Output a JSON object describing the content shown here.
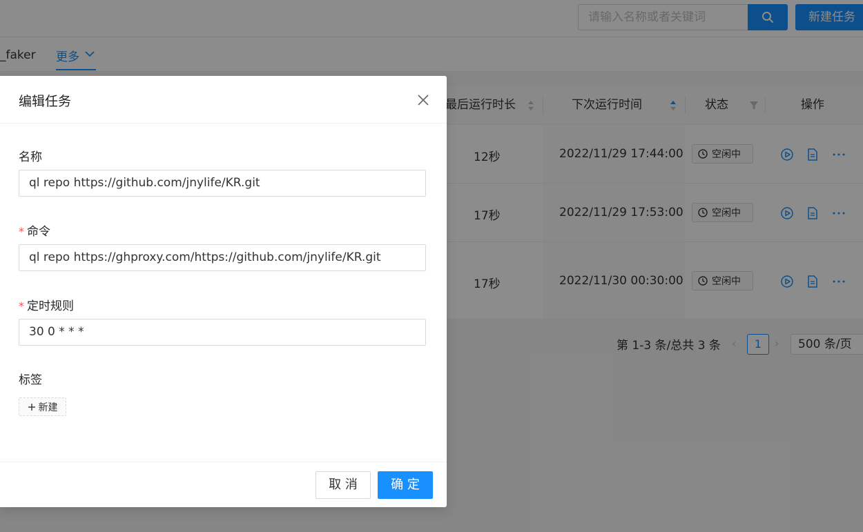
{
  "colors": {
    "accent": "#1890ff",
    "required": "#ff4d4f",
    "mask": "rgba(0,0,0,0.45)"
  },
  "header": {
    "search_placeholder": "请输入名称或者关键词",
    "new_task_label": "新建任务"
  },
  "tabs": {
    "faker_label": "_faker",
    "more_label": "更多"
  },
  "table": {
    "columns": [
      "最后运行时长",
      "下次运行时间",
      "状态",
      "操作"
    ],
    "rows": [
      {
        "duration": "12秒",
        "next_run": "2022/11/29 17:44:00",
        "status": "空闲中"
      },
      {
        "duration": "17秒",
        "next_run": "2022/11/29 17:53:00",
        "status": "空闲中"
      },
      {
        "duration": "17秒",
        "next_run": "2022/11/30 00:30:00",
        "status": "空闲中"
      }
    ]
  },
  "pagination": {
    "total": "第 1-3 条/总共 3 条",
    "current": "1",
    "page_size": "500 条/页"
  },
  "modal": {
    "title": "编辑任务",
    "name_label": "名称",
    "name_value": "ql repo https://github.com/jnylife/KR.git",
    "command_label": "命令",
    "command_value": "ql repo https://ghproxy.com/https://github.com/jnylife/KR.git",
    "schedule_label": "定时规则",
    "schedule_value": "30 0 * * *",
    "tags_label": "标签",
    "new_tag_label": "新建",
    "required_mark": "*",
    "cancel_label": "取 消",
    "ok_label": "确 定"
  }
}
